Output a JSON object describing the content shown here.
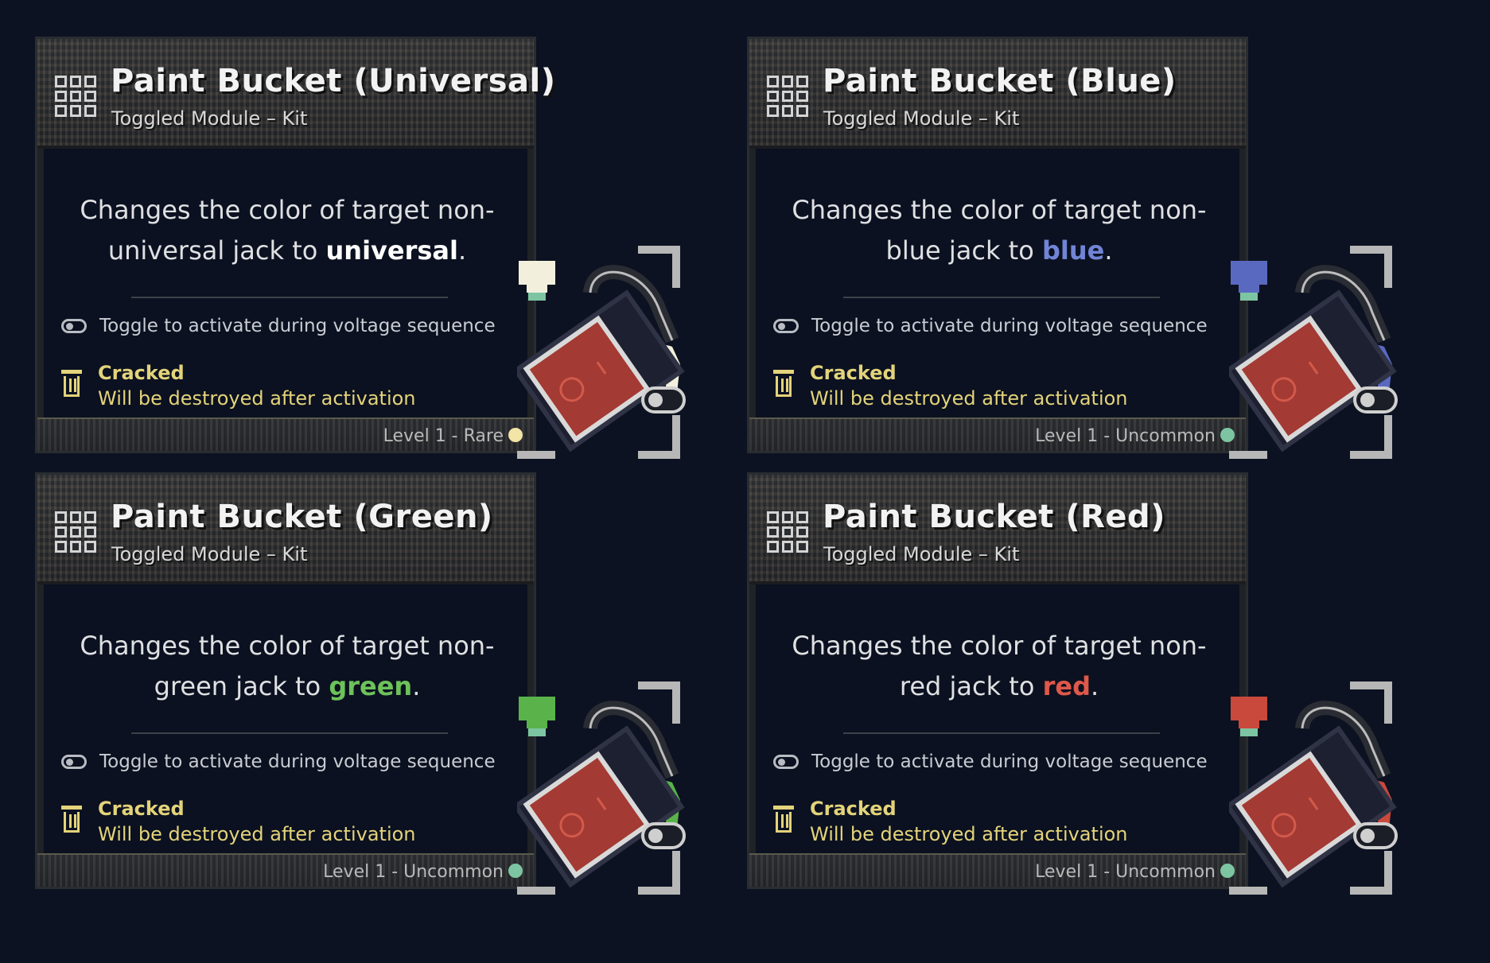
{
  "cards": [
    {
      "title": "Paint Bucket (Universal)",
      "subtitle": "Toggled Module – Kit",
      "desc_line1": "Changes the color of target non-",
      "desc_line2_pre": "universal jack to ",
      "desc_color_word": "universal",
      "desc_end": ".",
      "toggle_text": "Toggle to activate during voltage sequence",
      "cracked_title": "Cracked",
      "cracked_text": "Will be destroyed after activation",
      "level_text": "Level 1 - Rare",
      "color": "#f2f0dc",
      "word_color": "#ffffff",
      "dot_color": "#f2e4a6"
    },
    {
      "title": "Paint Bucket (Blue)",
      "subtitle": "Toggled Module – Kit",
      "desc_line1": "Changes the color of target non-",
      "desc_line2_pre": "blue jack to ",
      "desc_color_word": "blue",
      "desc_end": ".",
      "toggle_text": "Toggle to activate during voltage sequence",
      "cracked_title": "Cracked",
      "cracked_text": "Will be destroyed after activation",
      "level_text": "Level 1 - Uncommon",
      "color": "#5a69c0",
      "word_color": "#7284d6",
      "dot_color": "#7dc5a2"
    },
    {
      "title": "Paint Bucket (Green)",
      "subtitle": "Toggled Module – Kit",
      "desc_line1": "Changes the color of target non-",
      "desc_line2_pre": "green jack to ",
      "desc_color_word": "green",
      "desc_end": ".",
      "toggle_text": "Toggle to activate during voltage sequence",
      "cracked_title": "Cracked",
      "cracked_text": "Will be destroyed after activation",
      "level_text": "Level 1 - Uncommon",
      "color": "#59b34a",
      "word_color": "#6dc25a",
      "dot_color": "#7dc5a2"
    },
    {
      "title": "Paint Bucket (Red)",
      "subtitle": "Toggled Module – Kit",
      "desc_line1": "Changes the color of target non-",
      "desc_line2_pre": "red jack to ",
      "desc_color_word": "red",
      "desc_end": ".",
      "toggle_text": "Toggle to activate during voltage sequence",
      "cracked_title": "Cracked",
      "cracked_text": "Will be destroyed after activation",
      "level_text": "Level 1 - Uncommon",
      "color": "#c9493c",
      "word_color": "#e0584a",
      "dot_color": "#7dc5a2"
    }
  ],
  "icons": {
    "module": "module-grid-icon",
    "toggle": "toggle-icon",
    "cracked": "trash-icon",
    "art": "paint-bucket-icon",
    "art_switch": "toggle-switch-icon"
  }
}
